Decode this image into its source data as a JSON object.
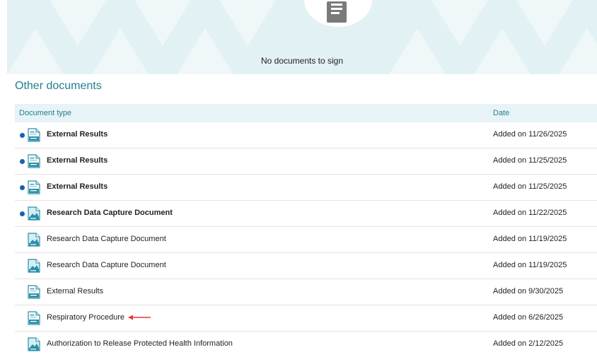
{
  "banner": {
    "empty_message": "No documents to sign"
  },
  "section": {
    "title": "Other documents"
  },
  "table": {
    "headers": {
      "type": "Document type",
      "date": "Date"
    },
    "rows": [
      {
        "name": "External Results",
        "date": "Added on 11/26/2025",
        "unread": true,
        "icon": "results-document-icon"
      },
      {
        "name": "External Results",
        "date": "Added on 11/25/2025",
        "unread": true,
        "icon": "results-document-icon"
      },
      {
        "name": "External Results",
        "date": "Added on 11/25/2025",
        "unread": true,
        "icon": "results-document-icon"
      },
      {
        "name": "Research Data Capture Document",
        "date": "Added on 11/22/2025",
        "unread": true,
        "icon": "data-capture-document-icon"
      },
      {
        "name": "Research Data Capture Document",
        "date": "Added on 11/19/2025",
        "unread": false,
        "icon": "data-capture-document-icon"
      },
      {
        "name": "Research Data Capture Document",
        "date": "Added on 11/19/2025",
        "unread": false,
        "icon": "data-capture-document-icon"
      },
      {
        "name": "External Results",
        "date": "Added on 9/30/2025",
        "unread": false,
        "icon": "results-document-icon"
      },
      {
        "name": "Respiratory Procedure",
        "date": "Added on 6/26/2025",
        "unread": false,
        "icon": "results-document-icon",
        "annotated": true
      },
      {
        "name": "Authorization to Release Protected Health Information",
        "date": "Added on 2/12/2025",
        "unread": false,
        "icon": "data-capture-document-icon"
      }
    ]
  },
  "colors": {
    "accent": "#1f7f91",
    "unread_dot": "#1a5fb4",
    "banner_bg": "#e2f1f4",
    "annotation_arrow": "#e53935"
  }
}
